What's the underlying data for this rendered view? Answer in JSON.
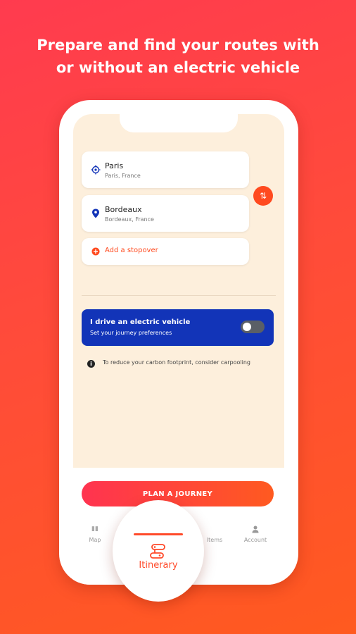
{
  "headline": {
    "line1": "Prepare and find your routes with",
    "line2": "or without an electric vehicle"
  },
  "route": {
    "origin": {
      "name": "Paris",
      "detail": "Paris, France",
      "icon": "crosshair-icon"
    },
    "destination": {
      "name": "Bordeaux",
      "detail": "Bordeaux, France",
      "icon": "location-pin-icon"
    },
    "stopover_label": "Add a stopover",
    "swap_icon": "swap-icon"
  },
  "ev_panel": {
    "title": "I drive an electric vehicle",
    "subtitle": "Set your journey preferences",
    "toggle_on": false
  },
  "info": {
    "text": "To reduce your carbon footprint, consider carpooling"
  },
  "plan_button": "PLAN A JOURNEY",
  "tabs": [
    {
      "label": "Map",
      "icon": "map-icon"
    },
    {
      "label": "Itinerary",
      "icon": "itinerary-icon",
      "active": true
    },
    {
      "label": "Items",
      "icon": "items-icon"
    },
    {
      "label": "Account",
      "icon": "account-icon"
    }
  ],
  "colors": {
    "accent": "#ff4a1f",
    "ev_panel": "#1234b8",
    "screen_bg": "#fdefdc"
  }
}
